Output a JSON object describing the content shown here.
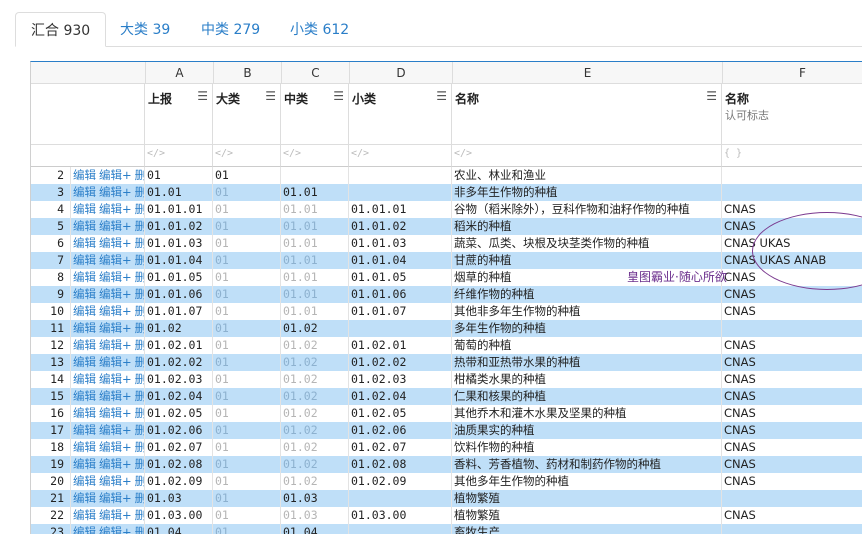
{
  "tabs": [
    {
      "label": "汇合 930",
      "active": true
    },
    {
      "label": "大类 39",
      "active": false
    },
    {
      "label": "中类 279",
      "active": false
    },
    {
      "label": "小类 612",
      "active": false
    }
  ],
  "columns": {
    "letters": [
      "A",
      "B",
      "C",
      "D",
      "E",
      "F"
    ],
    "headers": [
      {
        "title": "上报",
        "menu": "☰"
      },
      {
        "title": "大类",
        "menu": "☰"
      },
      {
        "title": "中类",
        "menu": "☰"
      },
      {
        "title": "小类",
        "menu": "☰"
      },
      {
        "title": "名称",
        "menu": "☰"
      },
      {
        "title": "名称",
        "subtitle": "认可标志"
      }
    ],
    "filter_icons": [
      "</>",
      "</>",
      "</>",
      "</>",
      "</>",
      "{ }"
    ]
  },
  "actions": {
    "edit": "编辑",
    "edit_plus": "编辑+",
    "delete": "删除"
  },
  "rows": [
    {
      "n": "2",
      "a": "01",
      "b": "01",
      "c": "",
      "d": "",
      "e": "农业、林业和渔业",
      "f": "",
      "hl": false,
      "dimB": false,
      "dimC": false
    },
    {
      "n": "3",
      "a": "01.01",
      "b": "01",
      "c": "01.01",
      "d": "",
      "e": "非多年生作物的种植",
      "f": "",
      "hl": true,
      "dimB": true,
      "dimC": false
    },
    {
      "n": "4",
      "a": "01.01.01",
      "b": "01",
      "c": "01.01",
      "d": "01.01.01",
      "e": "谷物（稻米除外），豆科作物和油籽作物的种植",
      "f": "CNAS",
      "hl": false,
      "dimB": true,
      "dimC": true
    },
    {
      "n": "5",
      "a": "01.01.02",
      "b": "01",
      "c": "01.01",
      "d": "01.01.02",
      "e": "稻米的种植",
      "f": "CNAS",
      "hl": true,
      "dimB": true,
      "dimC": true
    },
    {
      "n": "6",
      "a": "01.01.03",
      "b": "01",
      "c": "01.01",
      "d": "01.01.03",
      "e": "蔬菜、瓜类、块根及块茎类作物的种植",
      "f": "CNAS  UKAS",
      "hl": false,
      "dimB": true,
      "dimC": true
    },
    {
      "n": "7",
      "a": "01.01.04",
      "b": "01",
      "c": "01.01",
      "d": "01.01.04",
      "e": "甘蔗的种植",
      "f": "CNAS  UKAS  ANAB",
      "hl": true,
      "dimB": true,
      "dimC": true
    },
    {
      "n": "8",
      "a": "01.01.05",
      "b": "01",
      "c": "01.01",
      "d": "01.01.05",
      "e": "烟草的种植",
      "f": "CNAS",
      "hl": false,
      "dimB": true,
      "dimC": true
    },
    {
      "n": "9",
      "a": "01.01.06",
      "b": "01",
      "c": "01.01",
      "d": "01.01.06",
      "e": "纤维作物的种植",
      "f": "CNAS",
      "hl": true,
      "dimB": true,
      "dimC": true
    },
    {
      "n": "10",
      "a": "01.01.07",
      "b": "01",
      "c": "01.01",
      "d": "01.01.07",
      "e": "其他非多年生作物的种植",
      "f": "CNAS",
      "hl": false,
      "dimB": true,
      "dimC": true
    },
    {
      "n": "11",
      "a": "01.02",
      "b": "01",
      "c": "01.02",
      "d": "",
      "e": "多年生作物的种植",
      "f": "",
      "hl": true,
      "dimB": true,
      "dimC": false
    },
    {
      "n": "12",
      "a": "01.02.01",
      "b": "01",
      "c": "01.02",
      "d": "01.02.01",
      "e": "葡萄的种植",
      "f": "CNAS",
      "hl": false,
      "dimB": true,
      "dimC": true
    },
    {
      "n": "13",
      "a": "01.02.02",
      "b": "01",
      "c": "01.02",
      "d": "01.02.02",
      "e": "热带和亚热带水果的种植",
      "f": "CNAS",
      "hl": true,
      "dimB": true,
      "dimC": true
    },
    {
      "n": "14",
      "a": "01.02.03",
      "b": "01",
      "c": "01.02",
      "d": "01.02.03",
      "e": "柑橘类水果的种植",
      "f": "CNAS",
      "hl": false,
      "dimB": true,
      "dimC": true
    },
    {
      "n": "15",
      "a": "01.02.04",
      "b": "01",
      "c": "01.02",
      "d": "01.02.04",
      "e": "仁果和核果的种植",
      "f": "CNAS",
      "hl": true,
      "dimB": true,
      "dimC": true
    },
    {
      "n": "16",
      "a": "01.02.05",
      "b": "01",
      "c": "01.02",
      "d": "01.02.05",
      "e": "其他乔木和灌木水果及坚果的种植",
      "f": "CNAS",
      "hl": false,
      "dimB": true,
      "dimC": true
    },
    {
      "n": "17",
      "a": "01.02.06",
      "b": "01",
      "c": "01.02",
      "d": "01.02.06",
      "e": "油质果实的种植",
      "f": "CNAS",
      "hl": true,
      "dimB": true,
      "dimC": true
    },
    {
      "n": "18",
      "a": "01.02.07",
      "b": "01",
      "c": "01.02",
      "d": "01.02.07",
      "e": "饮料作物的种植",
      "f": "CNAS",
      "hl": false,
      "dimB": true,
      "dimC": true
    },
    {
      "n": "19",
      "a": "01.02.08",
      "b": "01",
      "c": "01.02",
      "d": "01.02.08",
      "e": "香料、芳香植物、药材和制药作物的种植",
      "f": "CNAS",
      "hl": true,
      "dimB": true,
      "dimC": true
    },
    {
      "n": "20",
      "a": "01.02.09",
      "b": "01",
      "c": "01.02",
      "d": "01.02.09",
      "e": "其他多年生作物的种植",
      "f": "CNAS",
      "hl": false,
      "dimB": true,
      "dimC": true
    },
    {
      "n": "21",
      "a": "01.03",
      "b": "01",
      "c": "01.03",
      "d": "",
      "e": "植物繁殖",
      "f": "",
      "hl": true,
      "dimB": true,
      "dimC": false
    },
    {
      "n": "22",
      "a": "01.03.00",
      "b": "01",
      "c": "01.03",
      "d": "01.03.00",
      "e": "植物繁殖",
      "f": "CNAS",
      "hl": false,
      "dimB": true,
      "dimC": true
    },
    {
      "n": "23",
      "a": "01.04",
      "b": "01",
      "c": "01.04",
      "d": "",
      "e": "畜牧生产",
      "f": "",
      "hl": true,
      "dimB": true,
      "dimC": false
    }
  ],
  "annotation": "皇图霸业·随心所欲"
}
